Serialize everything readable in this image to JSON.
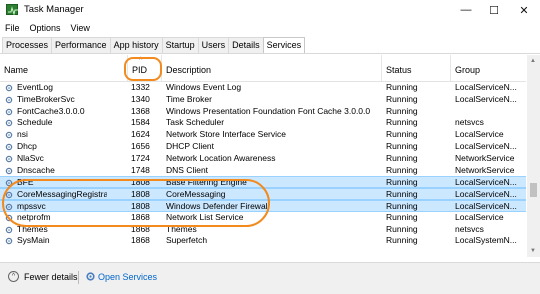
{
  "window": {
    "title": "Task Manager",
    "minimize": "—",
    "maximize": "☐",
    "close": "✕"
  },
  "menu": [
    "File",
    "Options",
    "View"
  ],
  "tabs": [
    "Processes",
    "Performance",
    "App history",
    "Startup",
    "Users",
    "Details",
    "Services"
  ],
  "active_tab": "Services",
  "columns": {
    "name": "Name",
    "pid": "PID",
    "description": "Description",
    "status": "Status",
    "group": "Group"
  },
  "rows": [
    {
      "name": "EventLog",
      "pid": "1332",
      "desc": "Windows Event Log",
      "status": "Running",
      "group": "LocalServiceN..."
    },
    {
      "name": "TimeBrokerSvc",
      "pid": "1340",
      "desc": "Time Broker",
      "status": "Running",
      "group": "LocalServiceN..."
    },
    {
      "name": "FontCache3.0.0.0",
      "pid": "1368",
      "desc": "Windows Presentation Foundation Font Cache 3.0.0.0",
      "status": "Running",
      "group": ""
    },
    {
      "name": "Schedule",
      "pid": "1584",
      "desc": "Task Scheduler",
      "status": "Running",
      "group": "netsvcs"
    },
    {
      "name": "nsi",
      "pid": "1624",
      "desc": "Network Store Interface Service",
      "status": "Running",
      "group": "LocalService"
    },
    {
      "name": "Dhcp",
      "pid": "1656",
      "desc": "DHCP Client",
      "status": "Running",
      "group": "LocalServiceN..."
    },
    {
      "name": "NlaSvc",
      "pid": "1724",
      "desc": "Network Location Awareness",
      "status": "Running",
      "group": "NetworkService"
    },
    {
      "name": "Dnscache",
      "pid": "1748",
      "desc": "DNS Client",
      "status": "Running",
      "group": "NetworkService"
    },
    {
      "name": "BFE",
      "pid": "1808",
      "desc": "Base Filtering Engine",
      "status": "Running",
      "group": "LocalServiceN...",
      "selected": true
    },
    {
      "name": "CoreMessagingRegistrar",
      "pid": "1808",
      "desc": "CoreMessaging",
      "status": "Running",
      "group": "LocalServiceN...",
      "selected": true
    },
    {
      "name": "mpssvc",
      "pid": "1808",
      "desc": "Windows Defender Firewall",
      "status": "Running",
      "group": "LocalServiceN...",
      "selected": true
    },
    {
      "name": "netprofm",
      "pid": "1868",
      "desc": "Network List Service",
      "status": "Running",
      "group": "LocalService"
    },
    {
      "name": "Themes",
      "pid": "1868",
      "desc": "Themes",
      "status": "Running",
      "group": "netsvcs"
    },
    {
      "name": "SysMain",
      "pid": "1868",
      "desc": "Superfetch",
      "status": "Running",
      "group": "LocalSystemN..."
    }
  ],
  "footer": {
    "fewer_details": "Fewer details",
    "open_services": "Open Services"
  },
  "colors": {
    "selection": "#cce8ff",
    "callout": "#f28a1e",
    "link": "#0066cc"
  }
}
